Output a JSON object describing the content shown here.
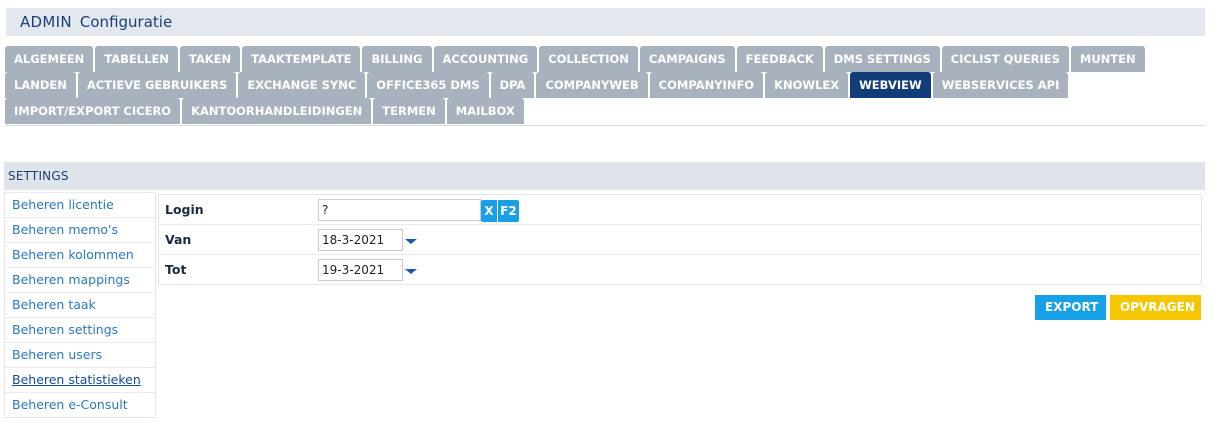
{
  "header": {
    "section": "ADMIN",
    "title": "Configuratie"
  },
  "tabs": {
    "row1": [
      "ALGEMEEN",
      "TABELLEN",
      "TAKEN",
      "TAAKTEMPLATE",
      "BILLING",
      "ACCOUNTING",
      "COLLECTION",
      "CAMPAIGNS",
      "FEEDBACK",
      "DMS SETTINGS",
      "CICLIST QUERIES",
      "MUNTEN"
    ],
    "row2": [
      "LANDEN",
      "ACTIEVE GEBRUIKERS",
      "EXCHANGE SYNC",
      "OFFICE365 DMS",
      "DPA",
      "COMPANYWEB",
      "COMPANYINFO",
      "KNOWLEX",
      "WEBVIEW",
      "WEBSERVICES API"
    ],
    "row3": [
      "IMPORT/EXPORT CICERO",
      "KANTOORHANDLEIDINGEN",
      "TERMEN",
      "MAILBOX"
    ],
    "active": "WEBVIEW"
  },
  "settings": {
    "title": "SETTINGS",
    "menu": [
      "Beheren licentie",
      "Beheren memo's",
      "Beheren kolommen",
      "Beheren mappings",
      "Beheren taak",
      "Beheren settings",
      "Beheren users",
      "Beheren statistieken",
      "Beheren e-Consult"
    ],
    "active_item": "Beheren statistieken"
  },
  "form": {
    "login": {
      "label": "Login",
      "value": "?",
      "clear_label": "X",
      "lookup_label": "F2"
    },
    "van": {
      "label": "Van",
      "value": "18-3-2021"
    },
    "tot": {
      "label": "Tot",
      "value": "19-3-2021"
    }
  },
  "actions": {
    "export_label": "EXPORT",
    "query_label": "OPVRAGEN"
  },
  "colors": {
    "tab": "#a8b2bf",
    "tab_active": "#123d7a",
    "link": "#2a78c5",
    "export": "#16a0e6",
    "query": "#f6c700"
  }
}
